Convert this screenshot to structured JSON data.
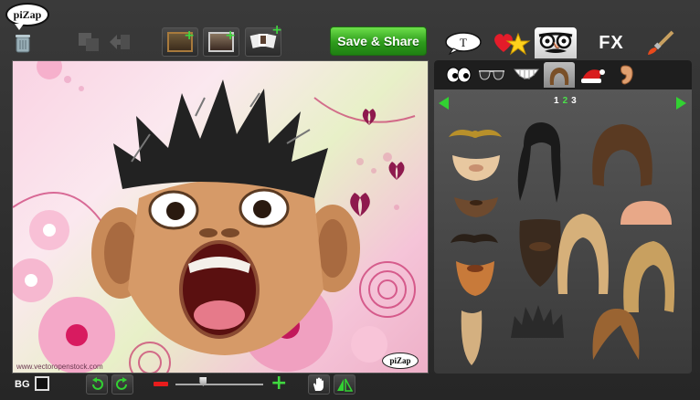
{
  "app": {
    "logo_text": "piZap"
  },
  "toolbar": {
    "save_label": "Save & Share",
    "tools": [
      {
        "name": "frame-photo-tool"
      },
      {
        "name": "add-photo-tool"
      },
      {
        "name": "collage-tool"
      }
    ]
  },
  "categories": [
    {
      "id": "text",
      "icon": "speech-bubble-icon",
      "label": "T"
    },
    {
      "id": "stickers",
      "icon": "heart-star-icon"
    },
    {
      "id": "faces",
      "icon": "disguise-glasses-icon",
      "active": true
    },
    {
      "id": "fx",
      "icon": "fx-icon",
      "label": "FX"
    },
    {
      "id": "paint",
      "icon": "paintbrush-icon"
    }
  ],
  "subcategories": [
    {
      "id": "eyes",
      "icon": "eyes-icon"
    },
    {
      "id": "glasses",
      "icon": "sunglasses-icon"
    },
    {
      "id": "mouth",
      "icon": "teeth-icon"
    },
    {
      "id": "hair",
      "icon": "hair-icon",
      "active": true
    },
    {
      "id": "hats",
      "icon": "santa-hat-icon"
    },
    {
      "id": "ears",
      "icon": "ear-icon"
    }
  ],
  "pagination": {
    "pages": [
      "1",
      "2",
      "3"
    ],
    "current": "2"
  },
  "canvas": {
    "watermark": "www.vectoropenstock.com",
    "badge_text": "piZap"
  },
  "bottom_bar": {
    "bg_label": "BG",
    "bg_color": "#111111",
    "zoom_level": 0.3
  },
  "colors": {
    "accent_green": "#32d232",
    "minus_red": "#e81c1c"
  }
}
